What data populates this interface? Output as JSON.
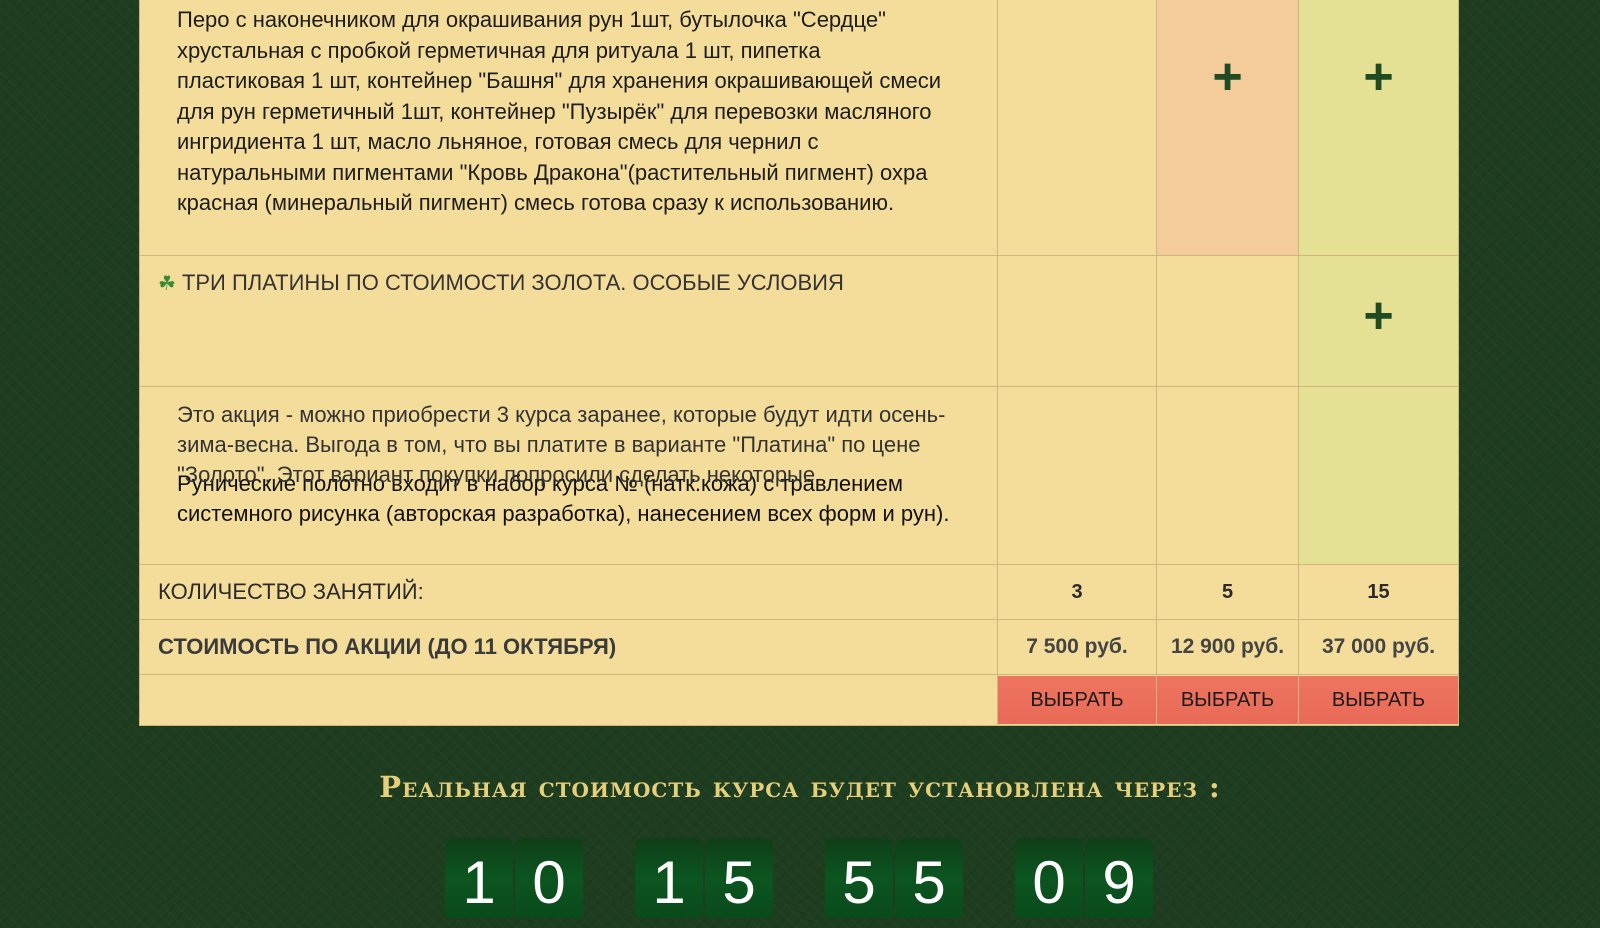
{
  "table": {
    "ingredients_text": "Перо с наконечником для окрашивания рун 1шт, бутылочка \"Сердце\" хрустальная с пробкой герметичная для ритуала 1 шт, пипетка пластиковая 1 шт, контейнер \"Башня\" для хранения окрашивающей смеси для рун герметичный 1шт, контейнер \"Пузырёк\" для перевозки масляного ингридиента 1 шт, масло льняное, готовая смесь для чернил с натуральными пигментами \"Кровь Дракона\"(растительный пигмент) охра красная (минеральный пигмент) смесь готова сразу к использованию.",
    "plus_symbol": "+",
    "feature_title": "ТРИ ПЛАТИНЫ ПО СТОИМОСТИ ЗОЛОТА. ОСОБЫЕ УСЛОВИЯ",
    "feature_icon": "leaf-icon",
    "promo_text": "Это акция - можно приобрести 3 курса заранее, которые будут идти осень-зима-весна. Выгода в том, что вы платите в варианте \"Платина\" по цене \"Золото\". Этот вариант покупки попросили сделать некоторые",
    "underlying_text": "Рунические полотно входит в набор курса № (натк.кожа) с травлением системного рисунка (авторская разработка), нанесением всех форм и рун).",
    "quantity_label": "КОЛИЧЕСТВО ЗАНЯТИЙ:",
    "quantities": [
      "3",
      "5",
      "15"
    ],
    "price_label": "СТОИМОСТЬ ПО АКЦИИ (ДО 11 ОКТЯБРЯ)",
    "prices": [
      "7 500 руб.",
      "12 900 руб.",
      "37 000 руб."
    ],
    "select_label": "ВЫБРАТЬ"
  },
  "countdown": {
    "heading": "Реальная стоимость курса будет установлена через :",
    "digits": [
      "1",
      "0",
      "1",
      "5",
      "5",
      "5",
      "0",
      "9"
    ]
  },
  "colors": {
    "background": "#1e3c1f",
    "table": "#f4dd9a",
    "peach_column": "#f3cc9a",
    "lime_column": "#e4e194",
    "button": "#e86a57",
    "heading": "#e6cf7a",
    "plus": "#1f4a22"
  }
}
